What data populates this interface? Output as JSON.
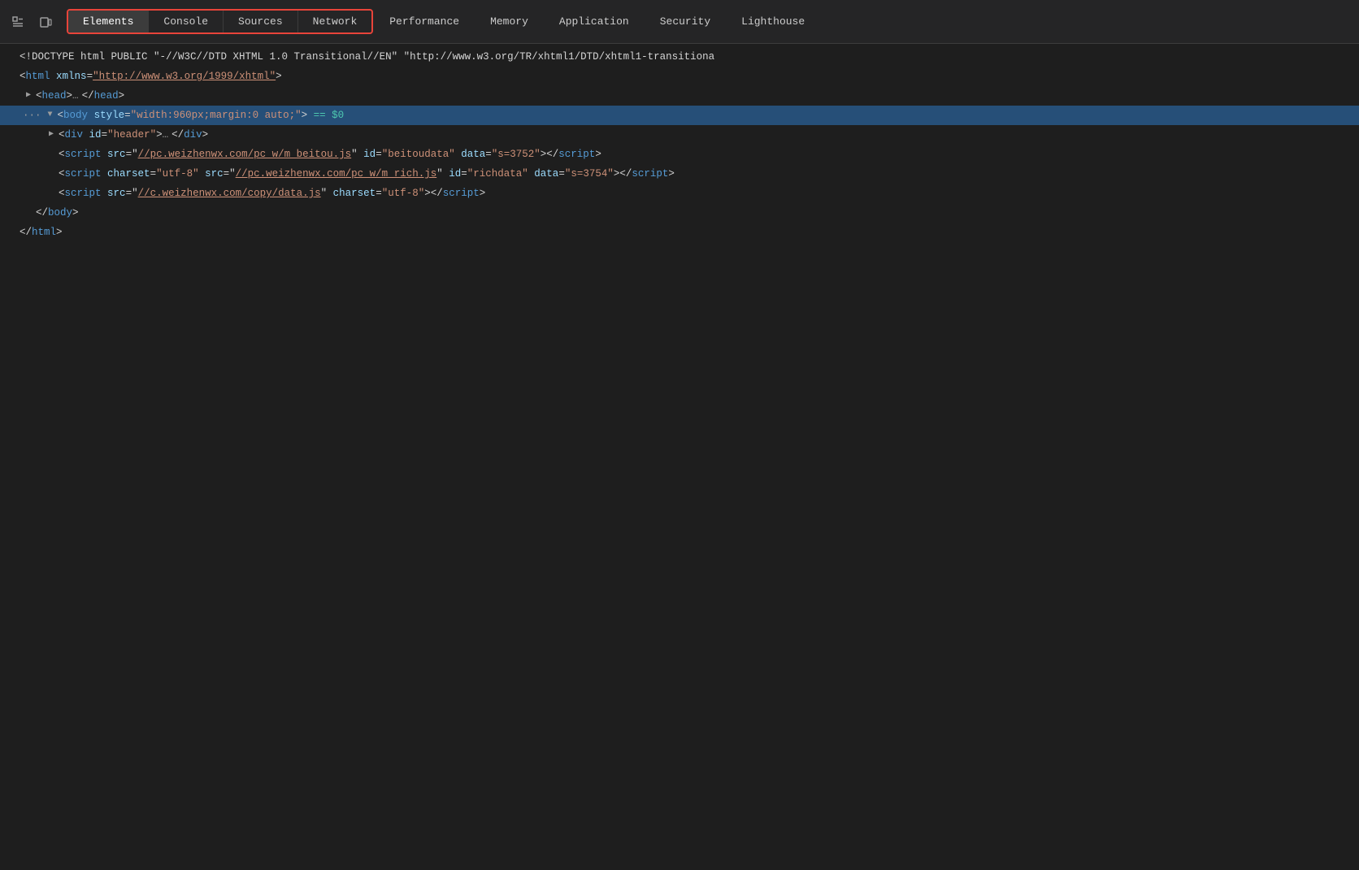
{
  "toolbar": {
    "inspect_icon": "⊹",
    "device_icon": "▭",
    "icons": [
      "inspect",
      "device"
    ]
  },
  "tabs": {
    "outlined_group": [
      {
        "id": "elements",
        "label": "Elements",
        "active": true
      },
      {
        "id": "console",
        "label": "Console",
        "active": false
      },
      {
        "id": "sources",
        "label": "Sources",
        "active": false
      },
      {
        "id": "network",
        "label": "Network",
        "active": false
      }
    ],
    "standalone": [
      {
        "id": "performance",
        "label": "Performance"
      },
      {
        "id": "memory",
        "label": "Memory"
      },
      {
        "id": "application",
        "label": "Application"
      },
      {
        "id": "security",
        "label": "Security"
      },
      {
        "id": "lighthouse",
        "label": "Lighthouse"
      }
    ]
  },
  "code": {
    "line1": "<!DOCTYPE html PUBLIC \"-//W3C//DTD XHTML 1.0 Transitional//EN\" \"http://www.w3.org/TR/xhtml1/DTD/xhtml1-transitiona",
    "line2_open": "<html xmlns=",
    "line2_value": "\"http://www.w3.org/1999/xhtml\"",
    "line2_close": ">",
    "line3_open": "<head>",
    "line3_ellipsis": "…",
    "line3_close": "</head>",
    "line4_tag": "body",
    "line4_attr": "style",
    "line4_value": "\"width:960px;margin:0 auto;\"",
    "line4_equals": "==",
    "line4_ref": "$0",
    "line5_tag_open": "div",
    "line5_attr": "id",
    "line5_value": "\"header\"",
    "line5_ellipsis": "…",
    "line5_close": "</div>",
    "line6_src1": "//pc.weizhenwx.com/pc_w/m_beitou.js",
    "line6_id": "beitoudata",
    "line6_data": "s=3752",
    "line7_charset": "utf-8",
    "line7_src2": "//pc.weizhenwx.com/pc_w/m_rich.js",
    "line7_id": "richdata",
    "line7_data": "s=3754",
    "line8_src3": "//c.weizhenwx.com/copy/data.js",
    "line8_charset": "utf-8",
    "line9_close_body": "</body>",
    "line10_close_html": "</html>"
  }
}
